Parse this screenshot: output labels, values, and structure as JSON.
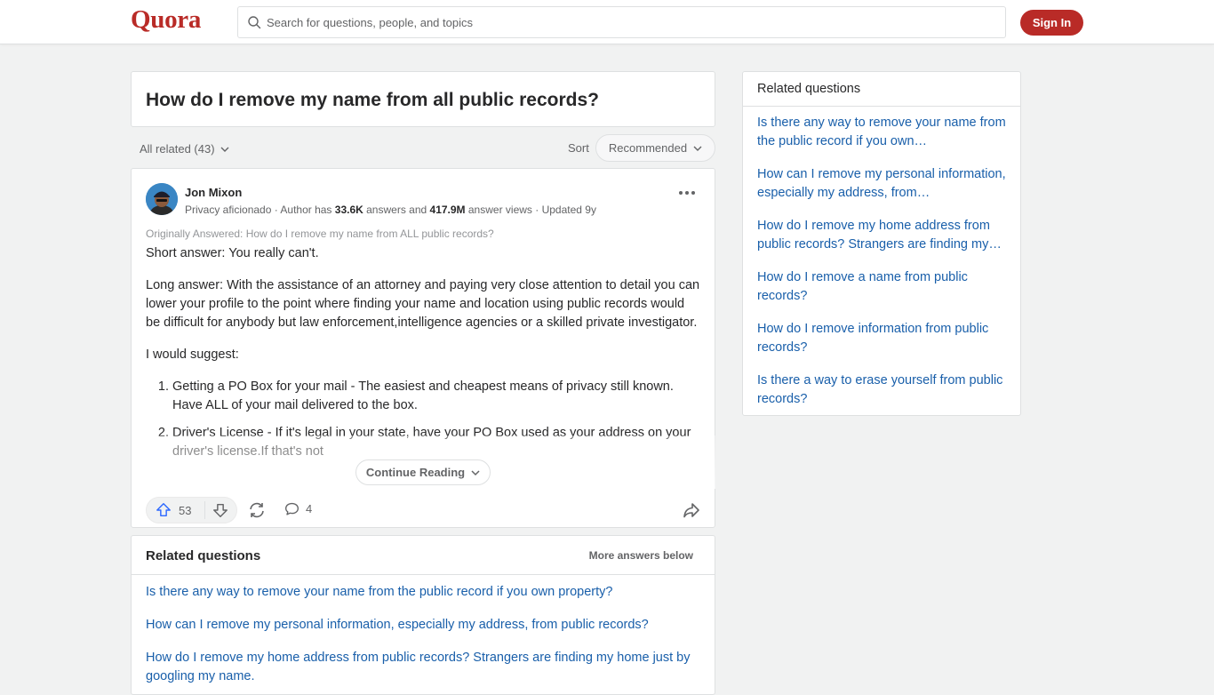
{
  "header": {
    "logo": "Quora",
    "search_placeholder": "Search for questions, people, and topics",
    "signin_label": "Sign In",
    "brand_color": "#b92b27"
  },
  "question": {
    "title": "How do I remove my name from all public records?"
  },
  "filters": {
    "all_related": "All related (43)",
    "sort_label": "Sort",
    "sort_value": "Recommended"
  },
  "answer": {
    "author": "Jon Mixon",
    "credential_prefix": "Privacy aficionado · Author has ",
    "answers_count": "33.6K",
    "answers_mid": " answers and ",
    "views_count": "417.9M",
    "views_suffix": " answer views · Updated 9y",
    "originally_answered": "Originally Answered: How do I remove my name from ALL public records?",
    "paragraphs": [
      "Short answer: You really can't.",
      "Long answer: With the assistance of an attorney and paying very close attention to detail you can lower your profile to the point where finding your name and location using public records would be difficult for anybody but law enforcement,intelligence agencies or a skilled private investigator.",
      "I would suggest:"
    ],
    "list_items": [
      "Getting a PO Box for your mail - The easiest and cheapest means of privacy still known. Have ALL of your mail delivered to the box.",
      "Driver's License - If it's legal in your state, have your PO Box used as your address on your driver's license.If that's not"
    ],
    "continue_label": "Continue Reading",
    "upvotes": "53",
    "comments": "4"
  },
  "related_inline": {
    "title": "Related questions",
    "more_label": "More answers below",
    "items": [
      "Is there any way to remove your name from the public record if you own property?",
      "How can I remove my personal information, especially my address, from public records?",
      "How do I remove my home address from public records? Strangers are finding my home just by googling my name."
    ]
  },
  "sidebar": {
    "title": "Related questions",
    "items": [
      "Is there any way to remove your name from the public record if you own…",
      "How can I remove my personal information, especially my address, from…",
      "How do I remove my home address from public records? Strangers are finding my…",
      "How do I remove a name from public records?",
      "How do I remove information from public records?",
      "Is there a way to erase yourself from public records?"
    ]
  }
}
